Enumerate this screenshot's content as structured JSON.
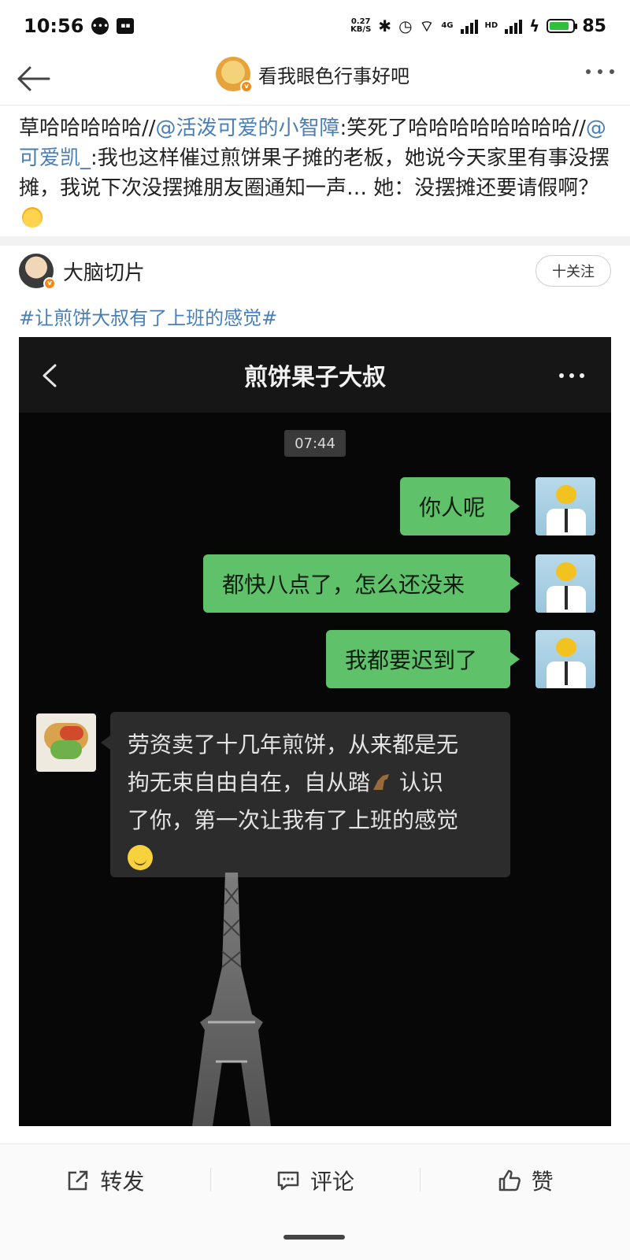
{
  "status_bar": {
    "time": "10:56",
    "net_speed_value": "0.27",
    "net_speed_unit": "KB/S",
    "battery": "85",
    "battery_level": 0.85,
    "network_label": "4G",
    "hd_label": "HD"
  },
  "nav": {
    "title": "看我眼色行事好吧"
  },
  "repost": {
    "part1": "草哈哈哈哈哈//",
    "mention1": "@活泼可爱的小智障",
    "part2": ":笑死了哈哈哈哈哈哈哈哈//",
    "mention2": "@可爱凯_",
    "part3": ":我也这样催过煎饼果子摊的老板，她说今天家里有事没摆摊，我说下次没摆摊朋友圈通知一声… 她：没摆摊还要请假啊？"
  },
  "post": {
    "username": "大脑切片",
    "follow_label": "十关注",
    "hashtag": "#让煎饼大叔有了上班的感觉#"
  },
  "chat": {
    "title": "煎饼果子大叔",
    "timestamp": "07:44",
    "messages": [
      {
        "side": "right",
        "text": "你人呢"
      },
      {
        "side": "right",
        "text": "都快八点了，怎么还没来"
      },
      {
        "side": "right",
        "text": "我都要迟到了"
      },
      {
        "side": "left",
        "line1": "劳资卖了十几年煎饼，从来都是无",
        "line2": "拘无束自由自在，自从踏",
        "line2b": "认识",
        "line3": "了你，第一次让我有了上班的感觉"
      }
    ]
  },
  "actions": {
    "repost": "转发",
    "comment": "评论",
    "like": "赞"
  },
  "colors": {
    "link": "#4a7fb5",
    "wechat_green": "#5fc26b",
    "battery_green": "#2fbf3a"
  }
}
